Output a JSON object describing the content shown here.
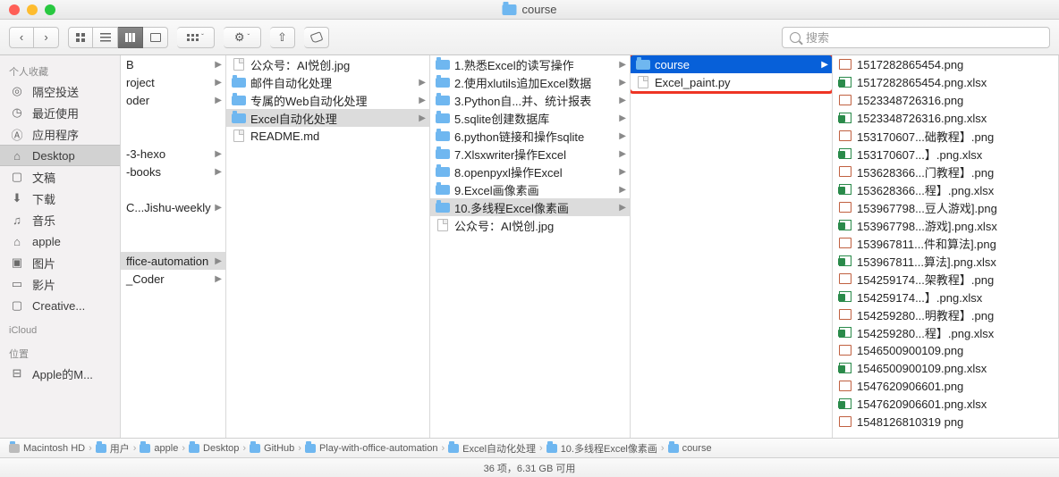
{
  "window_title": "course",
  "search_placeholder": "搜索",
  "sidebar": {
    "group1": "个人收藏",
    "items1": [
      {
        "icon": "airdrop",
        "label": "隔空投送"
      },
      {
        "icon": "clock",
        "label": "最近使用"
      },
      {
        "icon": "apps",
        "label": "应用程序"
      },
      {
        "icon": "desktop",
        "label": "Desktop",
        "sel": true
      },
      {
        "icon": "doc",
        "label": "文稿"
      },
      {
        "icon": "download",
        "label": "下载"
      },
      {
        "icon": "music",
        "label": "音乐"
      },
      {
        "icon": "home",
        "label": "apple"
      },
      {
        "icon": "pic",
        "label": "图片"
      },
      {
        "icon": "movie",
        "label": "影片"
      },
      {
        "icon": "folder",
        "label": "Creative..."
      }
    ],
    "group2": "iCloud",
    "group3": "位置",
    "items3": [
      {
        "icon": "disk",
        "label": "Apple的M..."
      }
    ]
  },
  "col0": [
    {
      "t": "B",
      "a": true
    },
    {
      "t": "roject",
      "a": true
    },
    {
      "t": "oder",
      "a": true
    },
    {
      "t": ""
    },
    {
      "t": ""
    },
    {
      "t": "-3-hexo",
      "a": true
    },
    {
      "t": "-books",
      "a": true
    },
    {
      "t": ""
    },
    {
      "t": "C...Jishu-weekly",
      "a": true
    },
    {
      "t": ""
    },
    {
      "t": ""
    },
    {
      "t": "ffice-automation",
      "a": true,
      "sel": true
    },
    {
      "t": "_Coder",
      "a": true
    }
  ],
  "col1": [
    {
      "ic": "doc",
      "t": "公众号：AI悦创.jpg"
    },
    {
      "ic": "fold",
      "t": "邮件自动化处理",
      "a": true
    },
    {
      "ic": "fold",
      "t": "专属的Web自动化处理",
      "a": true
    },
    {
      "ic": "fold",
      "t": "Excel自动化处理",
      "a": true,
      "sel": true
    },
    {
      "ic": "doc",
      "t": "README.md"
    }
  ],
  "col2": [
    {
      "ic": "fold",
      "t": "1.熟悉Excel的读写操作",
      "a": true
    },
    {
      "ic": "fold",
      "t": "2.使用xlutils追加Excel数据",
      "a": true
    },
    {
      "ic": "fold",
      "t": "3.Python自...并、统计报表",
      "a": true
    },
    {
      "ic": "fold",
      "t": "5.sqlite创建数据库",
      "a": true
    },
    {
      "ic": "fold",
      "t": "6.python链接和操作sqlite",
      "a": true
    },
    {
      "ic": "fold",
      "t": "7.Xlsxwriter操作Excel",
      "a": true
    },
    {
      "ic": "fold",
      "t": "8.openpyxl操作Excel",
      "a": true
    },
    {
      "ic": "fold",
      "t": "9.Excel画像素画",
      "a": true
    },
    {
      "ic": "fold",
      "t": "10.多线程Excel像素画",
      "a": true,
      "sel": true
    },
    {
      "ic": "doc",
      "t": "公众号：AI悦创.jpg"
    }
  ],
  "col3": [
    {
      "ic": "fold",
      "t": "course",
      "a": true,
      "sel": "blue"
    },
    {
      "ic": "doc",
      "t": "Excel_paint.py"
    }
  ],
  "col4": [
    {
      "ic": "png",
      "t": "1517282865454.png"
    },
    {
      "ic": "xls",
      "t": "1517282865454.png.xlsx"
    },
    {
      "ic": "png",
      "t": "1523348726316.png"
    },
    {
      "ic": "xls",
      "t": "1523348726316.png.xlsx"
    },
    {
      "ic": "png",
      "t": "153170607...础教程】.png"
    },
    {
      "ic": "xls",
      "t": "153170607...】.png.xlsx"
    },
    {
      "ic": "png",
      "t": "153628366...门教程】.png"
    },
    {
      "ic": "xls",
      "t": "153628366...程】.png.xlsx"
    },
    {
      "ic": "png",
      "t": "153967798...豆人游戏].png"
    },
    {
      "ic": "xls",
      "t": "153967798...游戏].png.xlsx"
    },
    {
      "ic": "png",
      "t": "153967811...件和算法].png"
    },
    {
      "ic": "xls",
      "t": "153967811...算法].png.xlsx"
    },
    {
      "ic": "png",
      "t": "154259174...架教程】.png"
    },
    {
      "ic": "xls",
      "t": "154259174...】.png.xlsx"
    },
    {
      "ic": "png",
      "t": "154259280...明教程】.png"
    },
    {
      "ic": "xls",
      "t": "154259280...程】.png.xlsx"
    },
    {
      "ic": "png",
      "t": "1546500900109.png"
    },
    {
      "ic": "xls",
      "t": "1546500900109.png.xlsx"
    },
    {
      "ic": "png",
      "t": "1547620906601.png"
    },
    {
      "ic": "xls",
      "t": "1547620906601.png.xlsx"
    },
    {
      "ic": "png",
      "t": "1548126810319 png"
    }
  ],
  "path": [
    "Macintosh HD",
    "用户",
    "apple",
    "Desktop",
    "GitHub",
    "Play-with-office-automation",
    "Excel自动化处理",
    "10.多线程Excel像素画",
    "course"
  ],
  "status": "36 项，6.31 GB 可用"
}
